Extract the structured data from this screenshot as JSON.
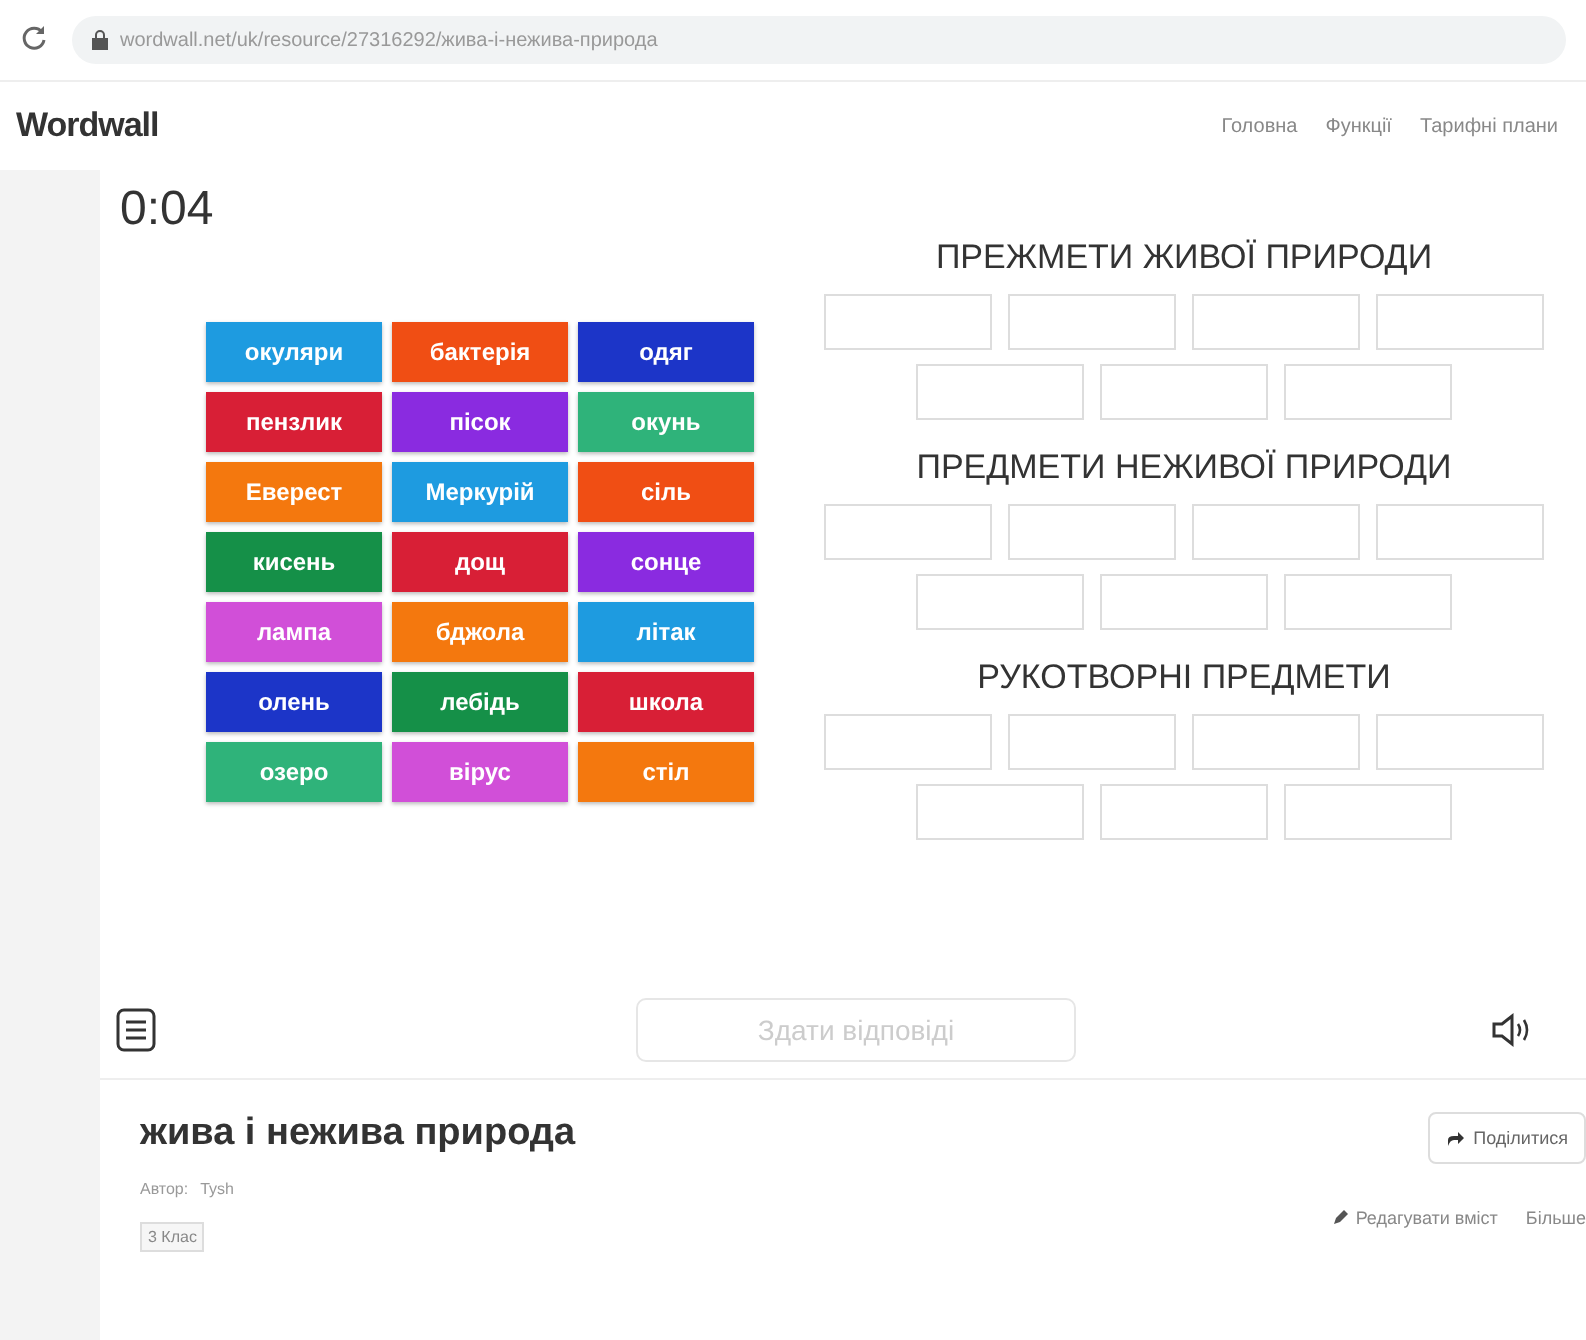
{
  "browser": {
    "url": "wordwall.net/uk/resource/27316292/жива-і-нежива-природа"
  },
  "header": {
    "logo": "Wordwall",
    "nav": [
      "Головна",
      "Функції",
      "Тарифні плани"
    ]
  },
  "game": {
    "timer": "0:04",
    "tiles": [
      {
        "label": "окуляри",
        "color": "#1e9be0"
      },
      {
        "label": "бактерія",
        "color": "#f04e14"
      },
      {
        "label": "одяг",
        "color": "#1c35c8"
      },
      {
        "label": "пензлик",
        "color": "#d81f36"
      },
      {
        "label": "пісок",
        "color": "#8a2be0"
      },
      {
        "label": "окунь",
        "color": "#2fb37a"
      },
      {
        "label": "Еверест",
        "color": "#f4780e"
      },
      {
        "label": "Меркурій",
        "color": "#1e9be0"
      },
      {
        "label": "сіль",
        "color": "#f04e14"
      },
      {
        "label": "кисень",
        "color": "#159048"
      },
      {
        "label": "дощ",
        "color": "#d81f36"
      },
      {
        "label": "сонце",
        "color": "#8a2be0"
      },
      {
        "label": "лампа",
        "color": "#d14fd8"
      },
      {
        "label": "бджола",
        "color": "#f4780e"
      },
      {
        "label": "літак",
        "color": "#1e9be0"
      },
      {
        "label": "олень",
        "color": "#1c35c8"
      },
      {
        "label": "лебідь",
        "color": "#159048"
      },
      {
        "label": "школа",
        "color": "#d81f36"
      },
      {
        "label": "озеро",
        "color": "#2fb37a"
      },
      {
        "label": "вірус",
        "color": "#d14fd8"
      },
      {
        "label": "стіл",
        "color": "#f4780e"
      }
    ],
    "groups": [
      {
        "title": "ПРЕЖМЕТИ ЖИВОЇ ПРИРОДИ"
      },
      {
        "title": "ПРЕДМЕТИ НЕЖИВОЇ ПРИРОДИ"
      },
      {
        "title": "РУКОТВОРНІ ПРЕДМЕТИ"
      }
    ],
    "submit": {
      "label": "Здати відповіді",
      "disabled": true
    }
  },
  "activity": {
    "title": "жива і нежива природа",
    "author_label": "Автор:",
    "author": "Tysh",
    "tag": "3 Клас",
    "share": "Поділитися",
    "edit": "Редагувати вміст",
    "more": "Більше"
  }
}
